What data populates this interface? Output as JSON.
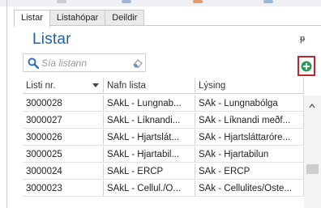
{
  "tabs": [
    "Listar",
    "Listahópar",
    "Deildir"
  ],
  "panel": {
    "title": "Listar",
    "pin_glyph": "ᵽ"
  },
  "search": {
    "placeholder": "Sía listann"
  },
  "table": {
    "columns": [
      "Listi nr.",
      "Nafn lista",
      "Lýsing"
    ],
    "rows": [
      [
        "3000028",
        "SAkL - Lungnab...",
        "SAk - Lungnabólga"
      ],
      [
        "3000027",
        "SAkL - Líknandi...",
        "SAk - Líknandi meðf..."
      ],
      [
        "3000026",
        "SAkL - Hjartslát...",
        "SAk - Hjartsláttaróre..."
      ],
      [
        "3000025",
        "SAkL - Hjartabil...",
        "SAk - Hjartabilun"
      ],
      [
        "3000024",
        "SAkL - ERCP",
        "SAk - ERCP"
      ],
      [
        "3000023",
        "SAkL - Cellul./O...",
        "SAk - Cellulites/Oste..."
      ]
    ]
  },
  "colors": {
    "accent": "#1f5fa8",
    "add_button": "#2a9a5a",
    "highlight_border": "#c0262b"
  },
  "icons": {
    "search": "magnifier-icon",
    "clear": "eraser-icon",
    "add": "plus-circle-icon",
    "pin": "pin-icon"
  }
}
